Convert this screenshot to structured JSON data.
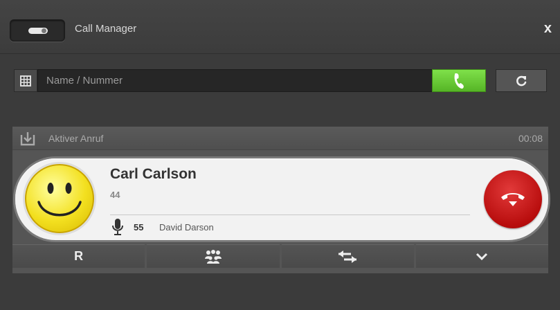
{
  "window": {
    "title": "Call Manager",
    "close_label": "x"
  },
  "search": {
    "placeholder": "Name / Nummer",
    "value": ""
  },
  "active_call": {
    "header_title": "Aktiver Anruf",
    "duration": "00:08",
    "caller_name": "Carl Carlson",
    "caller_number": "44",
    "line_number": "55",
    "line_name": "David Darson"
  },
  "actions": [
    {
      "label": "R",
      "icon": "recall-icon"
    },
    {
      "label": "",
      "icon": "conference-icon"
    },
    {
      "label": "",
      "icon": "transfer-icon"
    },
    {
      "label": "",
      "icon": "chevron-down-icon"
    }
  ],
  "colors": {
    "call_green": "#6ccb37",
    "hangup_red": "#c41414",
    "background": "#3b3b3b"
  }
}
